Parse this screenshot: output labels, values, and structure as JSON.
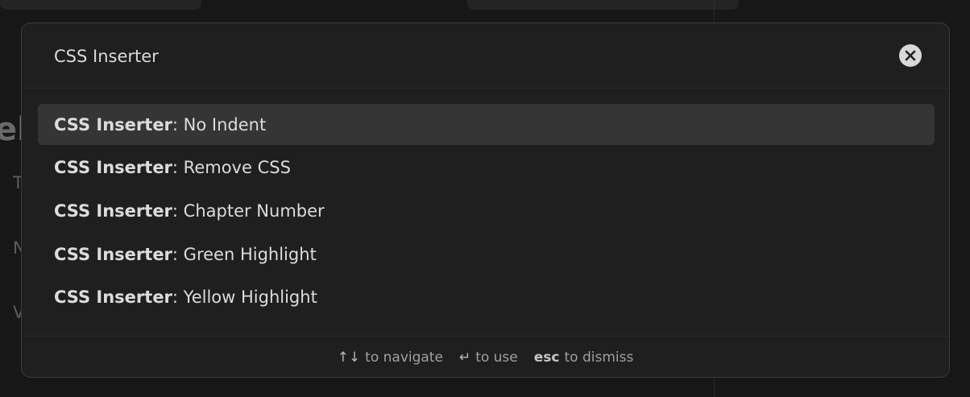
{
  "background": {
    "heading_fragment": "el",
    "line_fragments": [
      "T",
      "N",
      "V"
    ]
  },
  "modal": {
    "input_value": "CSS Inserter",
    "close_icon": "close-icon",
    "results": [
      {
        "prefix": "CSS Inserter",
        "separator": ":",
        "label": " No Indent"
      },
      {
        "prefix": "CSS Inserter",
        "separator": ":",
        "label": " Remove CSS"
      },
      {
        "prefix": "CSS Inserter",
        "separator": ":",
        "label": " Chapter Number"
      },
      {
        "prefix": "CSS Inserter",
        "separator": ":",
        "label": " Green Highlight"
      },
      {
        "prefix": "CSS Inserter",
        "separator": ":",
        "label": " Yellow Highlight"
      }
    ],
    "footer": {
      "navigate_key": "↑↓",
      "navigate_label": "to navigate",
      "use_key": "↵",
      "use_label": "to use",
      "dismiss_key": "esc",
      "dismiss_label": "to dismiss"
    }
  },
  "colors": {
    "modal_bg": "#1f1f1f",
    "selected_bg": "#353535",
    "text": "#dcdcdc",
    "muted": "#a0a0a0"
  }
}
